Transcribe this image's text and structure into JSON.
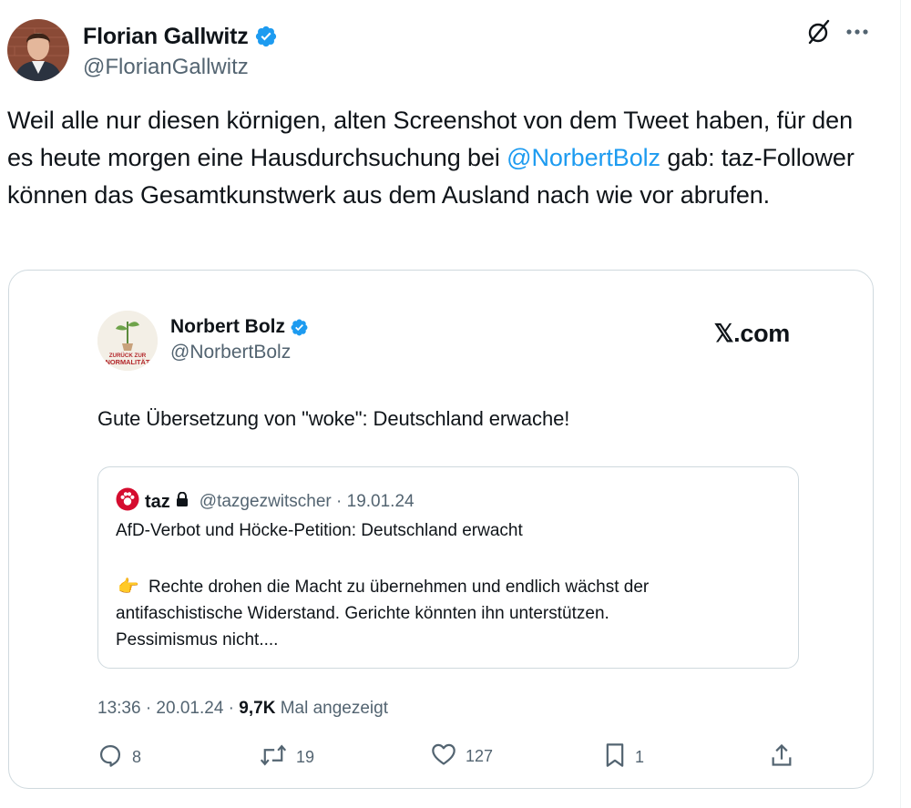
{
  "author": {
    "display_name": "Florian Gallwitz",
    "handle": "@FlorianGallwitz"
  },
  "tweet": {
    "text_before": "Weil alle nur diesen körnigen, alten Screenshot von dem Tweet haben, für den es heute morgen eine Hausdurchsuchung bei ",
    "mention": "@NorbertBolz",
    "text_after": " gab: taz-Follower können das Gesamtkunstwerk aus dem Ausland nach wie vor abrufen."
  },
  "embedded": {
    "display_name": "Norbert Bolz",
    "handle": "@NorbertBolz",
    "site_label": "𝕏.com",
    "avatar_text_1": "ZURÜCK ZUR",
    "avatar_text_2": "NORMALITÄT",
    "text": "Gute Übersetzung von \"woke\": Deutschland erwache!",
    "quote": {
      "name": "taz",
      "meta": "@tazgezwitscher · 19.01.24",
      "title": "AfD-Verbot und Höcke-Petition: Deutschland erwacht",
      "emoji": "👉",
      "body_first": "Rechte drohen die Macht zu übernehmen und endlich wächst der",
      "body_rest_1": "antifaschistische Widerstand. Gerichte könnten ihn unterstützen.",
      "body_rest_2": "Pessimismus nicht...."
    },
    "meta_prefix": "13:36 · 20.01.24 · ",
    "views_count": "9,7K",
    "views_suffix": " Mal angezeigt",
    "actions": {
      "replies": "8",
      "reposts": "19",
      "likes": "127",
      "bookmarks": "1"
    }
  },
  "colors": {
    "accent": "#1d9bf0",
    "text": "#0f1419",
    "secondary": "#536471",
    "border": "#cfd9de",
    "taz_red": "#d50c2f"
  },
  "icons": [
    "verified-badge-icon",
    "grok-icon",
    "more-icon",
    "lock-icon",
    "reply-icon",
    "repost-icon",
    "like-icon",
    "bookmark-icon",
    "share-icon"
  ]
}
